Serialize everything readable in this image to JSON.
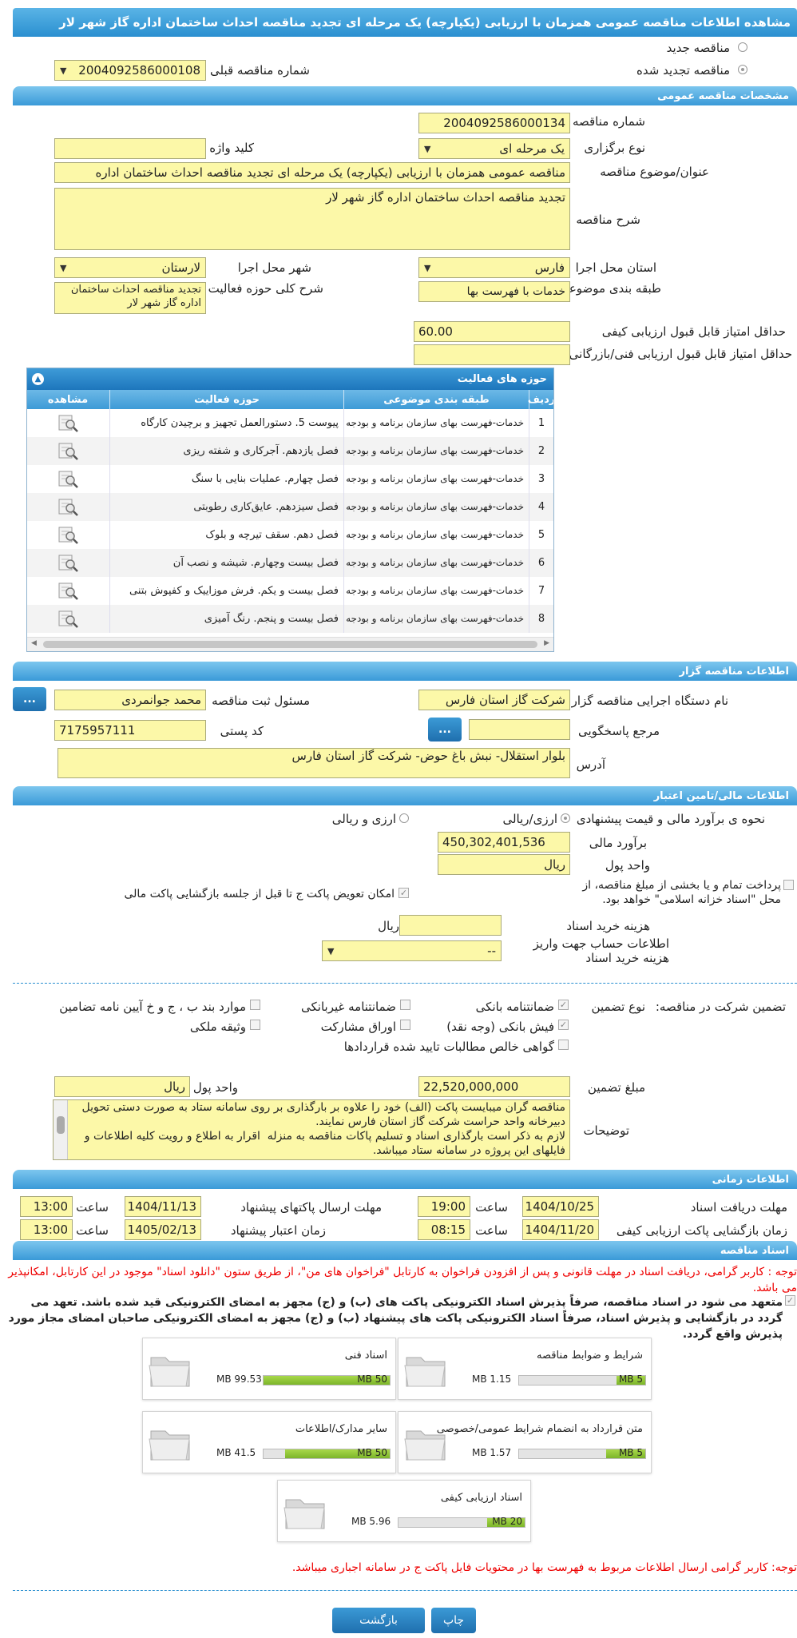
{
  "title": "مشاهده اطلاعات مناقصه عمومی همزمان با ارزیابی (یکپارچه) یک مرحله ای تجدید مناقصه احداث ساختمان اداره گاز شهر لار",
  "radios": {
    "new": "مناقصه جدید",
    "renewed": "مناقصه تجدید شده",
    "prev_label": "شماره مناقصه قبلی",
    "prev_value": "2004092586000108"
  },
  "sections": {
    "general": "مشخصات مناقصه عمومی",
    "activity": "حوزه های فعالیت",
    "organizer": "اطلاعات مناقصه گزار",
    "finance": "اطلاعات مالی/تامین اعتبار",
    "timing": "اطلاعات زمانی",
    "docs": "اسناد مناقصه"
  },
  "general": {
    "number_label": "شماره مناقصه",
    "number": "2004092586000134",
    "type_label": "نوع برگزاری",
    "type": "یک مرحله ای",
    "keyword_label": "کلید واژه",
    "keyword": "",
    "subject_label": "عنوان/موضوع مناقصه",
    "subject": "مناقصه عمومی همزمان با ارزیابی (یکپارچه) یک مرحله ای تجدید مناقصه احداث ساختمان اداره",
    "desc_label": "شرح مناقصه",
    "desc": "تجدید مناقصه احداث ساختمان اداره گاز شهر لار",
    "province_label": "استان محل اجرا",
    "province": "فارس",
    "city_label": "شهر محل اجرا",
    "city": "لارستان",
    "category_label": "طبقه بندی موضوعی",
    "category": "خدمات با فهرست بها",
    "scope_label": "شرح کلی حوزه فعالیت",
    "scope": "تجدید مناقصه احداث ساختمان اداره گاز شهر لار",
    "min_quality_label": "حداقل امتیاز قابل قبول ارزیابی کیفی",
    "min_quality": "60.00",
    "min_tech_label": "حداقل امتیاز قابل قبول ارزیابی فنی/بازرگانی",
    "min_tech": ""
  },
  "activity_table": {
    "headers": [
      "ردیف",
      "طبقه بندی موضوعی",
      "حوزه فعالیت",
      "مشاهده"
    ],
    "rows": [
      {
        "n": "1",
        "cat": "خدمات-فهرست بهای سازمان برنامه و بودجه",
        "act": "پیوست 5. دستورالعمل تجهیز و برچیدن کارگاه"
      },
      {
        "n": "2",
        "cat": "خدمات-فهرست بهای سازمان برنامه و بودجه",
        "act": "فصل یازدهم. آجرکاری و شفته ریزی"
      },
      {
        "n": "3",
        "cat": "خدمات-فهرست بهای سازمان برنامه و بودجه",
        "act": "فصل چهارم. عملیات بنایی با سنگ"
      },
      {
        "n": "4",
        "cat": "خدمات-فهرست بهای سازمان برنامه و بودجه",
        "act": "فصل سیزدهم. عایق‌کاری رطوبتی"
      },
      {
        "n": "5",
        "cat": "خدمات-فهرست بهای سازمان برنامه و بودجه",
        "act": "فصل دهم. سقف تیرچه و بلوک"
      },
      {
        "n": "6",
        "cat": "خدمات-فهرست بهای سازمان برنامه و بودجه",
        "act": "فصل بیست وچهارم. شیشه و نصب آن"
      },
      {
        "n": "7",
        "cat": "خدمات-فهرست بهای سازمان برنامه و بودجه",
        "act": "فصل بیست و یکم. فرش موزاییک و کفپوش بتنی"
      },
      {
        "n": "8",
        "cat": "خدمات-فهرست بهای سازمان برنامه و بودجه",
        "act": "فصل بیست و پنجم. رنگ آمیزی"
      }
    ]
  },
  "organizer": {
    "device_label": "نام دستگاه اجرایی مناقصه گزار",
    "device": "شرکت گاز استان فارس",
    "resp_label": "مسئول ثبت مناقصه",
    "resp": "محمد  جوانمردی",
    "ref_label": "مرجع پاسخگویی",
    "ref": "",
    "postal_label": "کد پستی",
    "postal": "7175957111",
    "address_label": "آدرس",
    "address": "بلوار استقلال- نبش باغ حوض- شرکت گاز استان فارس",
    "dots": "..."
  },
  "finance": {
    "method_label": "نحوه ی برآورد مالی و قیمت پیشنهادی",
    "opt1": "ارزی/ریالی",
    "opt2": "ارزی و ریالی",
    "estimate_label": "برآورد مالی",
    "estimate": "450,302,401,536",
    "currency_label": "واحد پول",
    "currency": "ریال",
    "islamic": "پرداخت تمام و یا بخشی از مبلغ مناقصه، از محل \"اسناد خزانه اسلامی\" خواهد بود.",
    "swap": "امکان تعویض پاکت ج تا قبل از جلسه بازگشایی پاکت مالی",
    "doc_cost_label": "هزینه خرید اسناد",
    "doc_cost": "",
    "doc_cost_unit": "ریال",
    "account_label": "اطلاعات حساب جهت واریز هزینه خرید اسناد",
    "account": "--",
    "guarantee_label": "تضمین شرکت در مناقصه:",
    "gtype_label": "نوع تضمین",
    "g1": "ضمانتنامه بانکی",
    "g2": "ضمانتنامه غیربانکی",
    "g3": "موارد بند ب ، ج و خ آیین نامه تضامین",
    "g4": "فیش بانکی (وجه نقد)",
    "g5": "اوراق مشارکت",
    "g6": "وثیقه ملکی",
    "g7": "گواهی خالص مطالبات تایید شده قراردادها",
    "amount_label": "مبلغ تضمین",
    "amount": "22,520,000,000",
    "amount_cur_label": "واحد پول",
    "amount_cur": "ریال",
    "notes_label": "توضیحات",
    "notes": "مناقصه گران میبایست پاکت (الف) خود را علاوه بر بارگذاری بر روی سامانه ستاد به صورت دستی تحویل دبیرخانه واحد حراست شرکت گاز استان فارس نمایند.\nلازم به ذکر است بارگذاری اسناد و تسلیم پاکات مناقصه به منزله  اقرار به اطلاع و رویت کلیه اطلاعات و فایلهای این پروژه در سامانه ستاد میباشد."
  },
  "timing": {
    "recv_label": "مهلت دریافت اسناد",
    "recv_date": "1404/10/25",
    "time_label": "ساعت",
    "recv_time": "19:00",
    "send_label": "مهلت ارسال پاکتهای پیشنهاد",
    "send_date": "1404/11/13",
    "send_time": "13:00",
    "open_label": "زمان بازگشایی پاکت ارزیابی کیفی",
    "open_date": "1404/11/20",
    "open_time": "08:15",
    "valid_label": "زمان اعتبار پیشنهاد",
    "valid_date": "1405/02/13",
    "valid_time": "13:00"
  },
  "docs": {
    "notice": "توجه : کاربر گرامی، دریافت اسناد در مهلت قانونی و پس از افزودن فراخوان به کارتابل \"فراخوان های من\"، از طریق ستون \"دانلود اسناد\" موجود در این کارتابل، امکانپذیر می باشد.",
    "commit": "متعهد می شود در اسناد مناقصه، صرفاً پذیرش اسناد الکترونیکی پاکت های (ب) و (ج) مجهز به امضای الکترونیکی قید شده باشد. تعهد می گردد در بازگشایی و پذیرش اسناد، صرفاً اسناد الکترونیکی پاکت های پیشنهاد (ب) و (ج) مجهز به امضای الکترونیکی صاحبان امضای مجاز مورد پذیرش واقع گردد.",
    "cards": [
      {
        "title": "شرایط و ضوابط مناقصه",
        "used": "1.15 MB",
        "max": "5 MB",
        "pct": 23
      },
      {
        "title": "اسناد فنی",
        "used": "99.53 MB",
        "max": "50 MB",
        "pct": 100
      },
      {
        "title": "متن قرارداد به انضمام شرایط عمومی/خصوصی",
        "used": "1.57 MB",
        "max": "5 MB",
        "pct": 31
      },
      {
        "title": "سایر مدارک/اطلاعات",
        "used": "41.5 MB",
        "max": "50 MB",
        "pct": 83
      },
      {
        "title": "اسناد ارزیابی کیفی",
        "used": "5.96 MB",
        "max": "20 MB",
        "pct": 30
      }
    ],
    "footnote": "توجه: کاربر گرامی ارسال اطلاعات مربوط به فهرست بها در محتویات فایل پاکت ج در سامانه اجباری میباشد."
  },
  "buttons": {
    "print": "چاپ",
    "back": "بازگشت"
  }
}
